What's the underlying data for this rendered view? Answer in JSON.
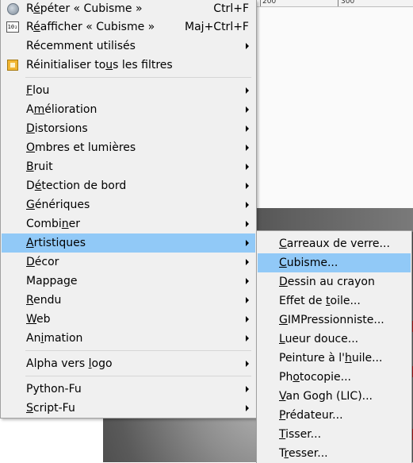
{
  "ruler": {
    "label_200": "200",
    "label_300": "300"
  },
  "menu": {
    "repeat_label_a": "R",
    "repeat_label_b": "é",
    "repeat_label_c": "péter « Cubisme »",
    "repeat_shortcut": "Ctrl+F",
    "reshow_label_a": "R",
    "reshow_label_b": "é",
    "reshow_label_c": "afficher « Cubisme »",
    "reshow_shortcut": "Maj+Ctrl+F",
    "recent_label": "Récemment utilisés",
    "reset_label_a": "Réinitialiser to",
    "reset_label_b": "u",
    "reset_label_c": "s les filtres",
    "items": [
      {
        "pre": "",
        "ul": "F",
        "post": "lou"
      },
      {
        "pre": "A",
        "ul": "m",
        "post": "élioration"
      },
      {
        "pre": "",
        "ul": "D",
        "post": "istorsions"
      },
      {
        "pre": "",
        "ul": "O",
        "post": "mbres et lumières"
      },
      {
        "pre": "",
        "ul": "B",
        "post": "ruit"
      },
      {
        "pre": "D",
        "ul": "é",
        "post": "tection de bord"
      },
      {
        "pre": "",
        "ul": "G",
        "post": "énériques"
      },
      {
        "pre": "Combi",
        "ul": "n",
        "post": "er"
      },
      {
        "pre": "",
        "ul": "A",
        "post": "rtistiques"
      },
      {
        "pre": "",
        "ul": "D",
        "post": "écor"
      },
      {
        "pre": "Mappa",
        "ul": "g",
        "post": "e"
      },
      {
        "pre": "",
        "ul": "R",
        "post": "endu"
      },
      {
        "pre": "",
        "ul": "W",
        "post": "eb"
      },
      {
        "pre": "An",
        "ul": "i",
        "post": "mation"
      }
    ],
    "alpha_logo": {
      "pre": "Alpha vers ",
      "ul": "l",
      "post": "ogo"
    },
    "python_fu": "Python-Fu",
    "script_fu": {
      "pre": "",
      "ul": "S",
      "post": "cript-Fu"
    }
  },
  "submenu": {
    "items": [
      {
        "pre": "",
        "ul": "C",
        "post": "arreaux de verre..."
      },
      {
        "pre": "",
        "ul": "C",
        "post": "ubisme..."
      },
      {
        "pre": "",
        "ul": "D",
        "post": "essin au crayon"
      },
      {
        "pre": "Effet de ",
        "ul": "t",
        "post": "oile..."
      },
      {
        "pre": "",
        "ul": "G",
        "post": "IMPressionniste..."
      },
      {
        "pre": "",
        "ul": "L",
        "post": "ueur douce..."
      },
      {
        "pre": "Peinture à l'",
        "ul": "h",
        "post": "uile..."
      },
      {
        "pre": "Ph",
        "ul": "o",
        "post": "tocopie..."
      },
      {
        "pre": "",
        "ul": "V",
        "post": "an Gogh (LIC)..."
      },
      {
        "pre": "",
        "ul": "P",
        "post": "rédateur..."
      },
      {
        "pre": "",
        "ul": "T",
        "post": "isser..."
      },
      {
        "pre": "T",
        "ul": "r",
        "post": "esser..."
      }
    ]
  },
  "colors": {
    "highlight": "#91c9f7",
    "menu_bg": "#f0f0f0",
    "accent_red": "#b01010"
  }
}
